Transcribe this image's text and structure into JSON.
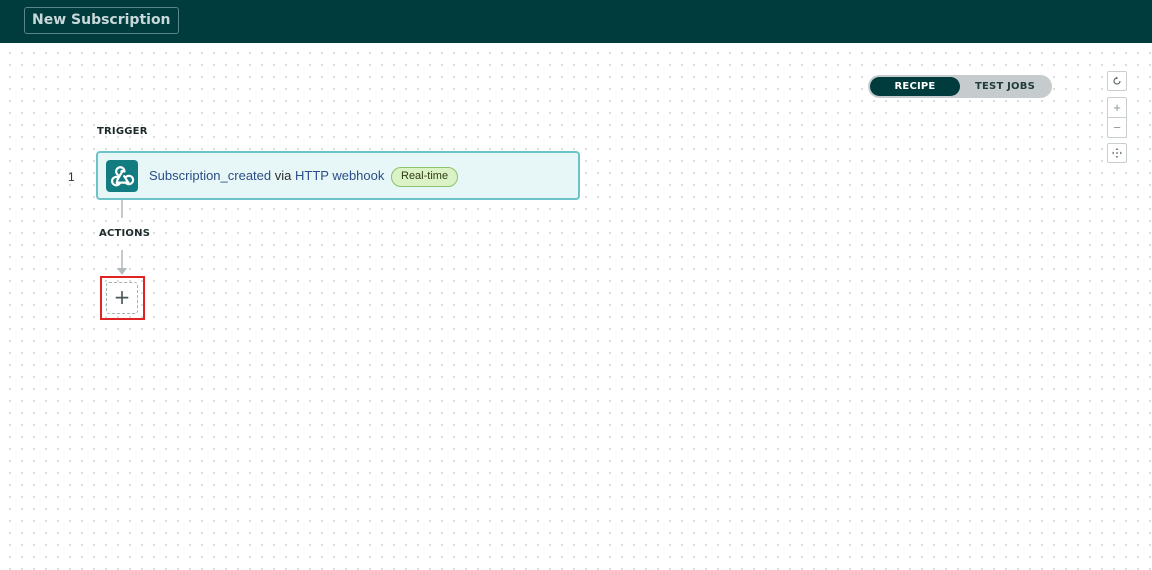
{
  "header": {
    "title": "New Subscription",
    "background": "#003b3e"
  },
  "view_toggle": {
    "options": [
      "RECIPE",
      "TEST JOBS"
    ],
    "selected": "RECIPE"
  },
  "canvas_controls": {
    "reset": "reset-icon",
    "zoom_in": "plus-icon",
    "zoom_out": "minus-icon",
    "fit": "fit-view-icon"
  },
  "recipe": {
    "trigger_label": "TRIGGER",
    "actions_label": "ACTIONS",
    "trigger": {
      "step_number": "1",
      "icon": "webhook-icon",
      "event": "Subscription_created",
      "via": "via",
      "connector": "HTTP webhook",
      "badge": "Real-time",
      "badge_color": "#dbf2c7"
    },
    "add_action_symbol": "+",
    "highlight_color": "#e02424"
  }
}
